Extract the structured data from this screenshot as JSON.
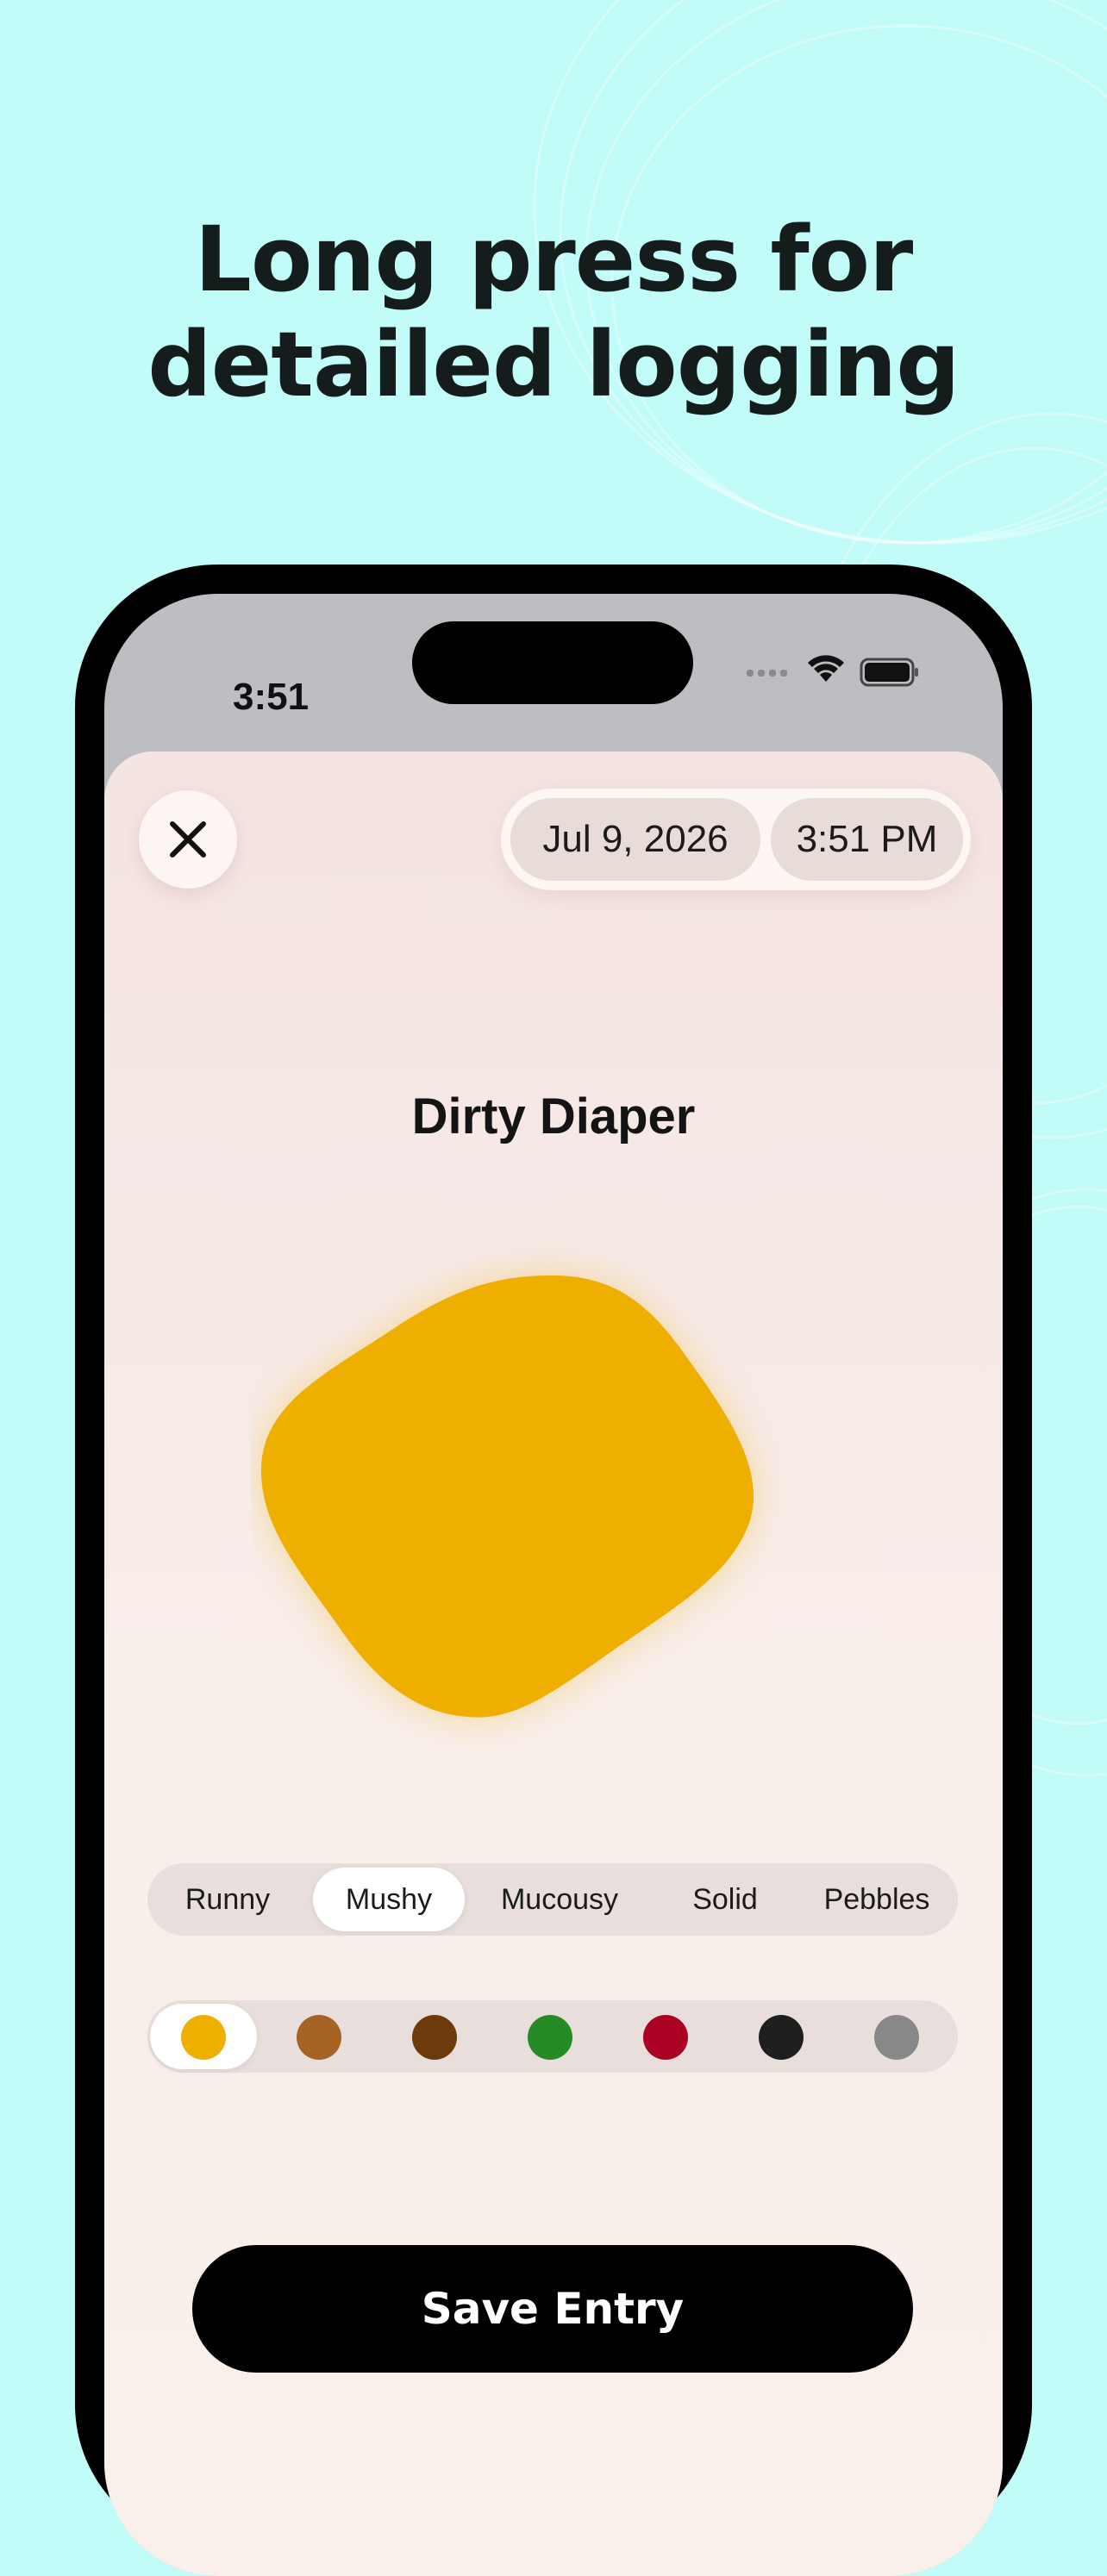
{
  "headline": {
    "line1": "Long press for",
    "line2": "detailed logging"
  },
  "status_bar": {
    "time": "3:51",
    "icons": [
      "cellular-icon",
      "wifi-icon",
      "battery-icon"
    ]
  },
  "entry": {
    "date": "Jul 9, 2026",
    "time": "3:51 PM",
    "title": "Dirty Diaper",
    "blob_color": "#eeaf00"
  },
  "consistency": {
    "options": [
      "Runny",
      "Mushy",
      "Mucousy",
      "Solid",
      "Pebbles"
    ],
    "selected": "Mushy"
  },
  "colors": {
    "swatches": [
      "#eeaf00",
      "#a66324",
      "#6e3a0b",
      "#268a26",
      "#aa0021",
      "#1f1f1f",
      "#888888"
    ],
    "selected_index": 0
  },
  "save_label": "Save Entry",
  "theme": {
    "background": "#c2fcf8",
    "accent": "#eeaf00"
  }
}
